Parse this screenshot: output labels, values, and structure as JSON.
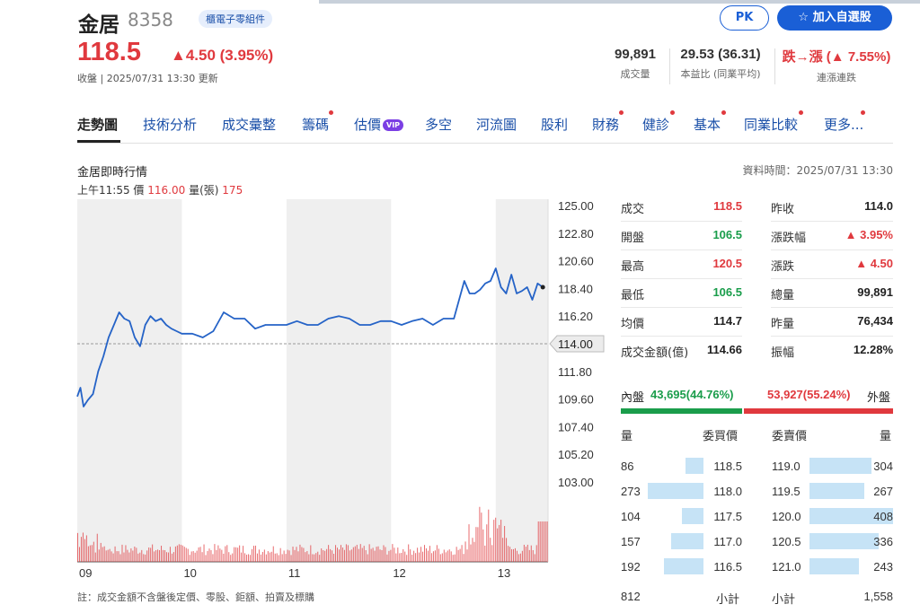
{
  "header": {
    "name": "金居",
    "code": "8358",
    "tag": "櫃電子零組件",
    "pk_label": "PK",
    "add_label": "☆  加入自選股",
    "price": "118.5",
    "change": "▲4.50 (3.95%)",
    "close_info": "收盤 | 2025/07/31 13:30 更新",
    "stats": [
      {
        "value": "99,891",
        "label": "成交量"
      },
      {
        "value": "29.53 (36.31)",
        "label": "本益比 (同業平均)"
      },
      {
        "value": "跌→漲 (▲ 7.55%)",
        "label": "連漲連跌",
        "color": "#e0393e"
      }
    ]
  },
  "tabs": [
    {
      "label": "走勢圖",
      "active": true,
      "dot": false
    },
    {
      "label": "技術分析",
      "dot": false
    },
    {
      "label": "成交彙整",
      "dot": false
    },
    {
      "label": "籌碼",
      "dot": true
    },
    {
      "label": "估價",
      "vip": "VIP",
      "dot": false
    },
    {
      "label": "多空",
      "dot": false
    },
    {
      "label": "河流圖",
      "dot": false
    },
    {
      "label": "股利",
      "dot": false
    },
    {
      "label": "財務",
      "dot": true
    },
    {
      "label": "健診",
      "dot": true
    },
    {
      "label": "基本",
      "dot": true
    },
    {
      "label": "同業比較",
      "dot": true
    },
    {
      "label": "更多...",
      "dot": true
    }
  ],
  "chart_section": {
    "title": "金居即時行情",
    "data_time": "資料時間：2025/07/31 13:30",
    "tick_time": "上午11:55",
    "tick_price_label": "價",
    "tick_price": "116.00",
    "tick_vol_label": "量(張)",
    "tick_vol": "175",
    "note": "註：成交金額不含盤後定價、零股、鉅額、拍賣及標購"
  },
  "chart_data": {
    "type": "line",
    "title": "金居即時行情",
    "x_tick_labels": [
      "09",
      "10",
      "11",
      "12",
      "13"
    ],
    "y_tick_labels": [
      "125.00",
      "122.80",
      "120.60",
      "118.40",
      "116.20",
      "114.00",
      "111.80",
      "109.60",
      "107.40",
      "105.20",
      "103.00"
    ],
    "ylim": [
      103.0,
      125.0
    ],
    "xlim_hours": [
      9.0,
      13.5
    ],
    "reference_price": 114.0,
    "reference_label": "114.00",
    "line_color": "#2563c7",
    "series": [
      {
        "x": [
          9.0,
          9.03,
          9.06,
          9.1,
          9.15,
          9.2,
          9.25,
          9.3,
          9.35,
          9.4,
          9.45,
          9.5,
          9.55,
          9.6,
          9.65,
          9.7,
          9.75,
          9.8,
          9.85,
          9.9,
          9.95,
          10.0,
          10.1,
          10.2,
          10.3,
          10.4,
          10.5,
          10.6,
          10.7,
          10.8,
          10.9,
          11.0,
          11.1,
          11.2,
          11.3,
          11.4,
          11.5,
          11.6,
          11.7,
          11.8,
          11.9,
          12.0,
          12.1,
          12.2,
          12.3,
          12.4,
          12.5,
          12.6,
          12.7,
          12.75,
          12.8,
          12.85,
          12.9,
          12.95,
          13.0,
          13.05,
          13.1,
          13.15,
          13.2,
          13.25,
          13.3,
          13.35,
          13.4,
          13.45
        ],
        "y": [
          109.8,
          110.5,
          109.0,
          109.5,
          110.0,
          111.8,
          113.0,
          114.5,
          115.5,
          116.5,
          116.0,
          115.8,
          114.5,
          113.8,
          115.5,
          116.2,
          115.8,
          116.0,
          115.5,
          115.2,
          115.0,
          114.8,
          114.8,
          114.5,
          115.0,
          116.5,
          116.0,
          116.0,
          115.2,
          115.5,
          115.5,
          115.5,
          115.8,
          115.5,
          115.5,
          116.0,
          116.2,
          116.0,
          115.5,
          115.5,
          115.8,
          115.8,
          115.5,
          115.8,
          116.0,
          115.5,
          116.0,
          116.0,
          119.0,
          118.0,
          118.0,
          118.3,
          118.8,
          119.0,
          120.0,
          118.5,
          118.0,
          119.5,
          118.0,
          118.2,
          118.5,
          117.5,
          118.8,
          118.5
        ]
      }
    ],
    "volume": {
      "color": "#e0393e",
      "note": "minute volume bars at the bottom of the chart, heavy at open and near 12:45 and 13:30"
    }
  },
  "quote": {
    "left": [
      {
        "label": "成交",
        "value": "118.5",
        "color": "red"
      },
      {
        "label": "開盤",
        "value": "106.5",
        "color": "green"
      },
      {
        "label": "最高",
        "value": "120.5",
        "color": "red"
      },
      {
        "label": "最低",
        "value": "106.5",
        "color": "green"
      },
      {
        "label": "均價",
        "value": "114.7",
        "color": "plain"
      },
      {
        "label": "成交金額(億)",
        "value": "114.66",
        "color": "plain"
      }
    ],
    "right": [
      {
        "label": "昨收",
        "value": "114.0",
        "color": "plain"
      },
      {
        "label": "漲跌幅",
        "value": "▲ 3.95%",
        "color": "red"
      },
      {
        "label": "漲跌",
        "value": "▲ 4.50",
        "color": "red"
      },
      {
        "label": "總量",
        "value": "99,891",
        "color": "plain"
      },
      {
        "label": "昨量",
        "value": "76,434",
        "color": "plain"
      },
      {
        "label": "振幅",
        "value": "12.28%",
        "color": "plain"
      }
    ]
  },
  "inner_outer": {
    "inner_label": "內盤",
    "inner_value": "43,695(44.76%)",
    "outer_value": "53,927(55.24%)",
    "outer_label": "外盤",
    "inner_ratio": 0.4476
  },
  "order_book": {
    "hdr_bid_vol": "量",
    "hdr_bid_price": "委買價",
    "hdr_ask_price": "委賣價",
    "hdr_ask_vol": "量",
    "rows": [
      {
        "bid_vol": "86",
        "bid_price": "118.5",
        "ask_price": "119.0",
        "ask_vol": "304"
      },
      {
        "bid_vol": "273",
        "bid_price": "118.0",
        "ask_price": "119.5",
        "ask_vol": "267"
      },
      {
        "bid_vol": "104",
        "bid_price": "117.5",
        "ask_price": "120.0",
        "ask_vol": "408"
      },
      {
        "bid_vol": "157",
        "bid_price": "117.0",
        "ask_price": "120.5",
        "ask_vol": "336"
      },
      {
        "bid_vol": "192",
        "bid_price": "116.5",
        "ask_price": "121.0",
        "ask_vol": "243"
      }
    ],
    "bid_total": "812",
    "bid_total_label": "小計",
    "ask_total_label": "小計",
    "ask_total": "1,558"
  }
}
